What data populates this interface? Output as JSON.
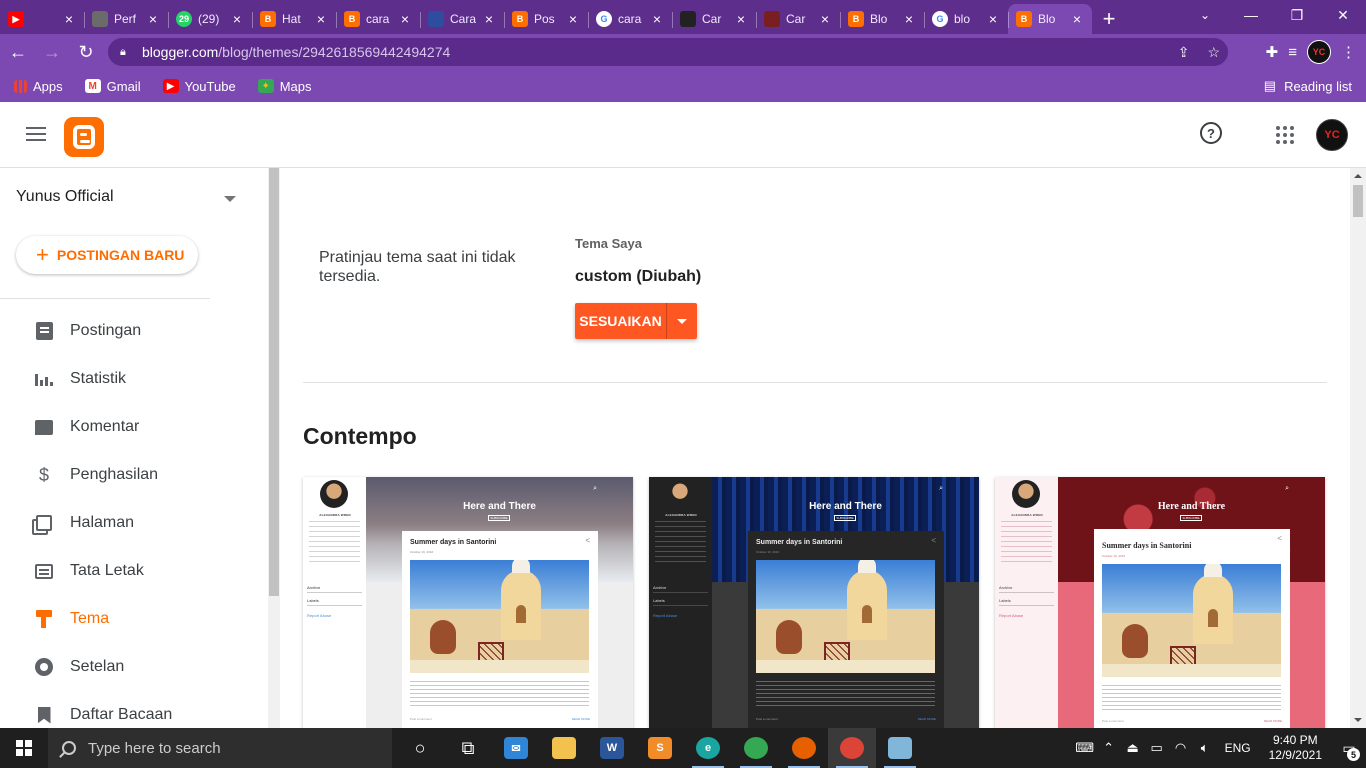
{
  "browser": {
    "tabs": [
      {
        "title": "",
        "favicon": "youtube-icon",
        "color": "#ff0000"
      },
      {
        "title": "Perf",
        "favicon": "perf-icon",
        "color": "#6b6b6b"
      },
      {
        "title": "(29)",
        "favicon": "whatsapp-icon",
        "color": "#25d366",
        "badge": "29"
      },
      {
        "title": "Hat",
        "favicon": "blogger-icon",
        "color": "#ff6e00"
      },
      {
        "title": "cara",
        "favicon": "blogger-icon",
        "color": "#ff6e00"
      },
      {
        "title": "Cara",
        "favicon": "flag-icon",
        "color": "#2e4d9e"
      },
      {
        "title": "Pos",
        "favicon": "blogger-icon",
        "color": "#ff6e00"
      },
      {
        "title": "cara",
        "favicon": "google-icon",
        "color": "#ffffff"
      },
      {
        "title": "Car",
        "favicon": "mic-icon",
        "color": "#222222"
      },
      {
        "title": "Car",
        "favicon": "red-x-icon",
        "color": "#7a1f1f"
      },
      {
        "title": "Blo",
        "favicon": "blogger-icon",
        "color": "#ff6e00"
      },
      {
        "title": "blo",
        "favicon": "google-icon",
        "color": "#ffffff"
      },
      {
        "title": "Blo",
        "favicon": "blogger-icon",
        "color": "#ff6e00",
        "active": true
      }
    ],
    "new_tab": "+",
    "url_host": "blogger.com",
    "url_path": "/blog/themes/2942618569442494274",
    "profile_initials": "YC",
    "bookmarks": [
      {
        "label": "Apps",
        "icon": "apps-grid-icon"
      },
      {
        "label": "Gmail",
        "icon": "gmail-icon"
      },
      {
        "label": "YouTube",
        "icon": "youtube-icon"
      },
      {
        "label": "Maps",
        "icon": "maps-icon"
      }
    ],
    "reading_list": "Reading list"
  },
  "blogger": {
    "help": "?",
    "avatar_initials": "YC",
    "blog_name": "Yunus Official",
    "new_post": "POSTINGAN BARU",
    "nav": [
      {
        "label": "Postingan",
        "icon": "posts-icon"
      },
      {
        "label": "Statistik",
        "icon": "stats-icon"
      },
      {
        "label": "Komentar",
        "icon": "comments-icon"
      },
      {
        "label": "Penghasilan",
        "icon": "dollar-icon"
      },
      {
        "label": "Halaman",
        "icon": "pages-icon"
      },
      {
        "label": "Tata Letak",
        "icon": "layout-icon"
      },
      {
        "label": "Tema",
        "icon": "paint-roller-icon",
        "active": true
      },
      {
        "label": "Setelan",
        "icon": "gear-icon"
      },
      {
        "label": "Daftar Bacaan",
        "icon": "bookmark-icon"
      }
    ],
    "preview_unavailable": "Pratinjau tema saat ini tidak tersedia.",
    "my_theme_label": "Tema Saya",
    "my_theme_name": "custom (Diubah)",
    "customize": "SESUAIKAN",
    "section_title": "Contempo",
    "accent": "#ff6d00",
    "cards": [
      {
        "variant": "light",
        "blog_title": "Here and There",
        "post_title": "Summer days in Santorini",
        "author": "ALEXANDRA WREN",
        "archive": "Archive",
        "labels": "Labels",
        "report": "Report Abuse",
        "more": "SUBSCRIBE",
        "post_date": "October 16, 2016",
        "post_foot": "Post a comment",
        "read_more": "READ MORE"
      },
      {
        "variant": "dark",
        "blog_title": "Here and There",
        "post_title": "Summer days in Santorini",
        "author": "ALEXANDRA WREN",
        "archive": "Archive",
        "labels": "Labels",
        "report": "Report Abuse",
        "more": "SUBSCRIBE",
        "post_date": "October 16, 2016",
        "post_foot": "Post a comment",
        "read_more": "READ MORE"
      },
      {
        "variant": "rose",
        "blog_title": "Here and There",
        "post_title": "Summer days in Santorini",
        "author": "ALEXANDRA WREN",
        "archive": "Archive",
        "labels": "Labels",
        "report": "Report Abuse",
        "more": "SUBSCRIBE",
        "post_date": "October 16, 2016",
        "post_foot": "Post a comment",
        "read_more": "READ MORE"
      }
    ]
  },
  "taskbar": {
    "search_placeholder": "Type here to search",
    "apps": [
      {
        "name": "cortana-icon",
        "color": "#1f1f1f",
        "glyph": "○"
      },
      {
        "name": "task-view-icon",
        "color": "#1f1f1f",
        "glyph": "⧉"
      },
      {
        "name": "mail-icon",
        "color": "#2f86d6",
        "glyph": "✉"
      },
      {
        "name": "file-explorer-icon",
        "color": "#f2c14e",
        "glyph": ""
      },
      {
        "name": "word-icon",
        "color": "#2b579a",
        "glyph": "W"
      },
      {
        "name": "sublime-icon",
        "color": "#f28c28",
        "glyph": "S"
      },
      {
        "name": "edge-icon",
        "color": "#1aa5a1",
        "glyph": "e"
      },
      {
        "name": "chrome-icon",
        "color": "#34a853",
        "glyph": ""
      },
      {
        "name": "firefox-icon",
        "color": "#e66000",
        "glyph": ""
      },
      {
        "name": "chrome-profile-icon",
        "color": "#db4437",
        "glyph": ""
      },
      {
        "name": "notepad-icon",
        "color": "#7fb6d9",
        "glyph": ""
      }
    ],
    "language": "ENG",
    "time": "9:40 PM",
    "date": "12/9/2021",
    "notifications": "5"
  }
}
